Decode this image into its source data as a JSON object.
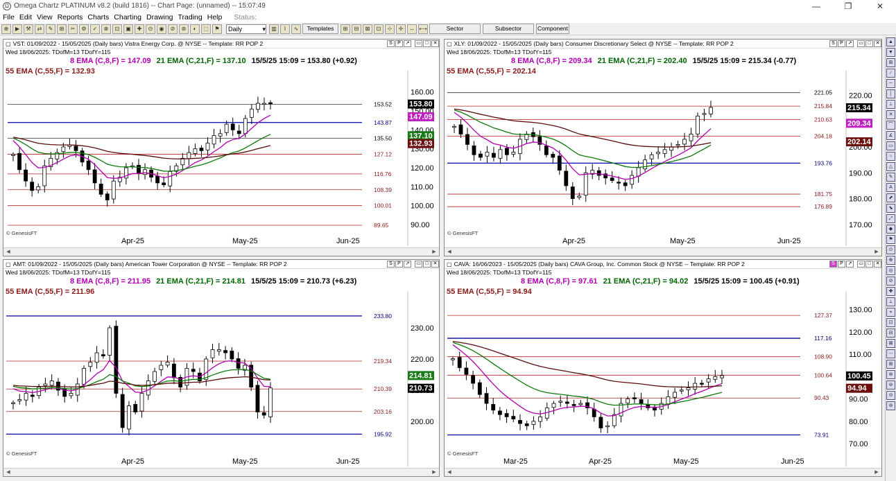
{
  "app": {
    "title": "Omega Chartz PLATINUM v8.2 (build 1816)  --  Chart Page: (unnamed)  --  15:07:49"
  },
  "window": {
    "min": "—",
    "restore": "❐",
    "close": "✕"
  },
  "menu": {
    "items": [
      "File",
      "Edit",
      "View",
      "Reports",
      "Charts",
      "Charting",
      "Drawing",
      "Trading",
      "Help"
    ],
    "status": "Status:"
  },
  "toolbar": {
    "period": "Daily",
    "templates": "Templates",
    "sector": "Sector",
    "subsector": "Subsector",
    "component": "Component"
  },
  "icons": {
    "pane": "chart-icon",
    "scroll_left": "arrow-left-icon",
    "scroll_right": "arrow-right-icon"
  },
  "panes": [
    {
      "header": "VST:  01/09/2022 - 15/05/2025  (Daily bars)   Vistra Energy Corp. @ NYSE  --  Template: RR POP 2",
      "sub": "Wed  18/06/2025:  TDofM=13  TDofY=115",
      "ema8": "8 EMA (C,8,F) = 147.09",
      "ema21": "21 EMA (C,21,F) = 137.10",
      "last": "15/5/25 15:09 = 153.80 (+0.92)",
      "ema55": "55 EMA (C,55,F) = 132.93",
      "axis": [
        "160.00",
        "150.00",
        "140.00",
        "130.00",
        "120.00",
        "110.00",
        "100.00",
        "90.00"
      ],
      "levels": [
        "153.52",
        "143.87",
        "135.50",
        "127.12",
        "116.76",
        "108.39",
        "100.01",
        "89.65"
      ],
      "tags": [
        "153.80",
        "147.09",
        "137.10",
        "132.93"
      ],
      "months": [
        "Apr-25",
        "May-25",
        "Jun-25"
      ],
      "copyright": "© GenesisFT",
      "buttons": [
        "S",
        "P",
        "↗",
        "▭",
        "□",
        "✕"
      ]
    },
    {
      "header": "XLY:  01/09/2022 - 15/05/2025  (Daily bars)   Consumer Discretionary Select @ NYSE  --  Template: RR POP 2",
      "sub": "Wed  18/06/2025:  TDofM=13  TDofY=115",
      "ema8": "8 EMA (C,8,F) = 209.34",
      "ema21": "21 EMA (C,21,F) = 202.40",
      "last": "15/5/25 15:09 = 215.34 (-0.77)",
      "ema55": "55 EMA (C,55,F) = 202.14",
      "axis": [
        "220.00",
        "210.00",
        "200.00",
        "190.00",
        "180.00",
        "170.00"
      ],
      "levels": [
        "221.05",
        "215.84",
        "210.63",
        "204.18",
        "193.76",
        "181.75",
        "176.89"
      ],
      "tags": [
        "215.34",
        "209.34",
        "202.14"
      ],
      "months": [
        "Apr-25",
        "May-25",
        "Jun-25"
      ],
      "copyright": "© GenesisFT",
      "buttons": [
        "S",
        "P",
        "↗",
        "▭",
        "□",
        "✕"
      ]
    },
    {
      "header": "AMT:  01/09/2022 - 15/05/2025  (Daily bars)   American Tower Corporation @ NYSE  --  Template: RR POP 2",
      "sub": "Wed  18/06/2025:  TDofM=13  TDofY=115",
      "ema8": "8 EMA (C,8,F) = 211.95",
      "ema21": "21 EMA (C,21,F) = 214.81",
      "last": "15/5/25 15:09 = 210.73 (+6.23)",
      "ema55": "55 EMA (C,55,F) = 211.96",
      "axis": [
        "230.00",
        "220.00",
        "210.00",
        "200.00"
      ],
      "levels": [
        "233.80",
        "219.34",
        "210.39",
        "203.16",
        "195.92"
      ],
      "tags": [
        "214.81",
        "210.73"
      ],
      "months": [
        "Apr-25",
        "May-25",
        "Jun-25"
      ],
      "copyright": "© GenesisFT",
      "buttons": [
        "S",
        "P",
        "↗",
        "▭",
        "□",
        "✕"
      ]
    },
    {
      "header": "CAVA:  16/06/2023 - 15/05/2025  (Daily bars)   CAVA Group, Inc. Common Stock @ NYSE  --  Template: RR POP 2",
      "sub": "Wed  18/06/2025:  TDofM=13  TDofY=115",
      "ema8": "8 EMA (C,8,F) = 97.61",
      "ema21": "21 EMA (C,21,F) = 94.02",
      "last": "15/5/25 15:09 = 100.45 (+0.91)",
      "ema55": "55 EMA (C,55,F) = 94.94",
      "axis": [
        "130.00",
        "120.00",
        "110.00",
        "100.00",
        "90.00",
        "80.00",
        "70.00"
      ],
      "levels": [
        "127.37",
        "117.16",
        "108.90",
        "100.64",
        "90.43",
        "73.91"
      ],
      "tags": [
        "100.45",
        "94.94"
      ],
      "months": [
        "Mar-25",
        "Apr-25",
        "May-25",
        "Jun-25"
      ],
      "copyright": "© GenesisFT",
      "buttons": [
        "S",
        "P",
        "↗",
        "▭",
        "□",
        "✕"
      ]
    }
  ],
  "colors": {
    "ema8": "#b000b0",
    "ema21": "#006400",
    "ema55": "#6b0f0f",
    "blue_level": "#0000aa",
    "red_level": "#a00000",
    "up": "#ffffff",
    "down": "#000000"
  }
}
